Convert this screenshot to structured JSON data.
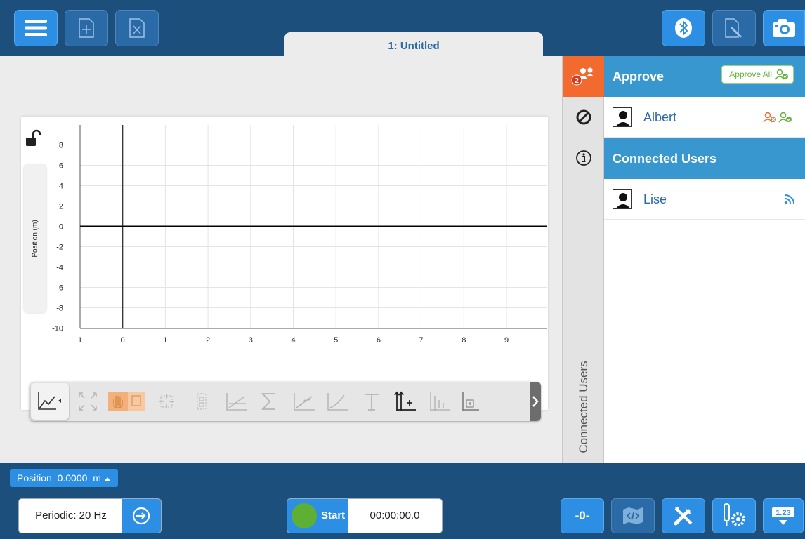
{
  "top": {
    "tab_title": "1: Untitled"
  },
  "graph": {
    "y_axis_label": "Position (m)",
    "y_ticks": [
      "8",
      "6",
      "4",
      "2",
      "0",
      "-2",
      "-4",
      "-6",
      "-8",
      "-10"
    ],
    "x_ticks": [
      "1",
      "0",
      "1",
      "2",
      "3",
      "4",
      "5",
      "6",
      "7",
      "8",
      "9"
    ]
  },
  "side": {
    "approve_badge": "2",
    "tab_label": "Connected Users"
  },
  "panel": {
    "approve_header": "Approve",
    "approve_all": "Approve All",
    "pending_user": "Albert",
    "connected_header": "Connected Users",
    "connected_user": "Lise"
  },
  "bottom": {
    "meter_label": "Position",
    "meter_value": "0.0000",
    "meter_unit": "m",
    "rate": "Periodic: 20 Hz",
    "start_label": "Start",
    "timer": "00:00:00.0",
    "zero_label": "-0-",
    "meter_badge": "1.23"
  },
  "colors": {
    "chrome": "#1d4f7c",
    "accent_blue": "#2d8fe3",
    "panel_header": "#3897cf",
    "approve_orange": "#f26a2e",
    "start_green": "#5db033"
  }
}
